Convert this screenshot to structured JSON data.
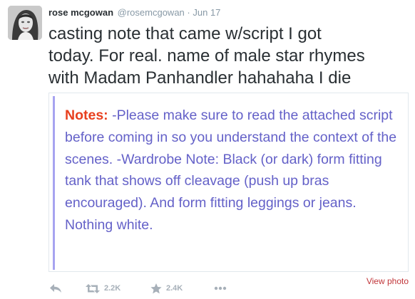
{
  "tweet": {
    "author_name": "rose mcgowan",
    "handle": "@rosemcgowan",
    "separator": "·",
    "date": "Jun 17",
    "text": "casting note that came w/script I got\ntoday. For real. name of male star rhymes\nwith Madam Panhandler hahahaha I die"
  },
  "media": {
    "note_label": "Notes:",
    "note_body": " -Please make sure to read the attached script before coming in so you understand the context of the scenes. -Wardrobe Note: Black (or dark) form fitting tank that shows off cleavage (push up bras encouraged). And form fitting leggings or jeans. Nothing white.",
    "view_photo": "View photo"
  },
  "actions": {
    "reply_icon": "reply-icon",
    "retweet_icon": "retweet-icon",
    "retweet_count": "2.2K",
    "favorite_icon": "star-icon",
    "favorite_count": "2.4K",
    "more_icon": "more-dots-icon"
  },
  "colors": {
    "name": "#292f33",
    "meta": "#8899a6",
    "note_text": "#6461c8",
    "note_label": "#e8401f",
    "view_photo": "#c1363a",
    "action_icons": "#a7b0b9"
  }
}
